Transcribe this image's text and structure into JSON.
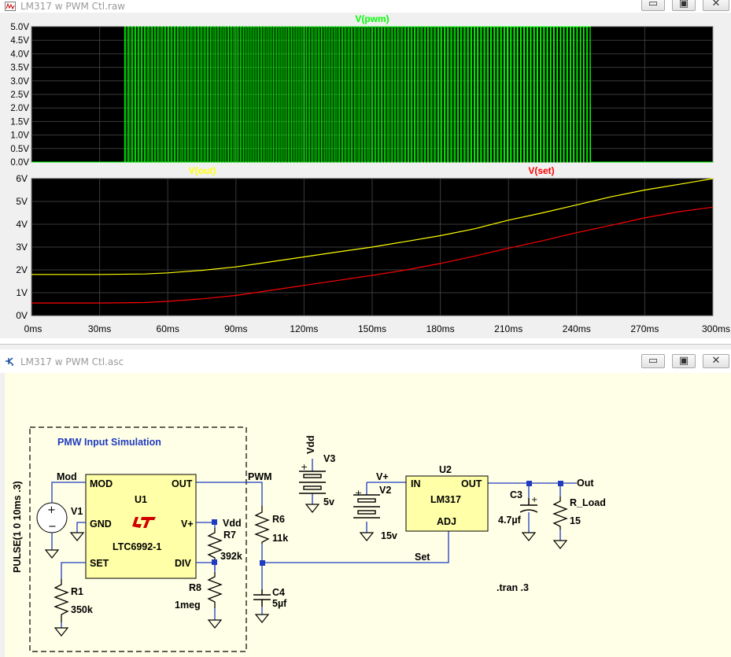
{
  "plot_window": {
    "title": "LM317 w PWM Ctl.raw",
    "controls": {
      "minimize": "▭",
      "restore": "▣",
      "close": "✕"
    }
  },
  "schematic_window": {
    "title": "LM317 w PWM Ctl.asc",
    "controls": {
      "minimize": "▭",
      "restore": "▣",
      "close": "✕"
    }
  },
  "chart_data": [
    {
      "type": "line",
      "title": "",
      "series": [
        {
          "name": "V(pwm)",
          "color": "#00ff00",
          "x_on": [
            41,
            246
          ],
          "low": 0,
          "high": 5
        }
      ],
      "ylim": [
        0,
        5.0
      ],
      "y_ticks": [
        "5.0V",
        "4.5V",
        "4.0V",
        "3.5V",
        "3.0V",
        "2.5V",
        "2.0V",
        "1.5V",
        "1.0V",
        "0.5V",
        "0.0V"
      ],
      "xlim": [
        0,
        300
      ],
      "grid": true,
      "background": "#000000"
    },
    {
      "type": "line",
      "title": "",
      "series": [
        {
          "name": "V(out)",
          "color": "#ffff00",
          "x": [
            0,
            30,
            50,
            60,
            75,
            90,
            105,
            120,
            135,
            150,
            165,
            180,
            195,
            210,
            225,
            240,
            255,
            270,
            285,
            300
          ],
          "y": [
            1.8,
            1.8,
            1.82,
            1.87,
            1.98,
            2.13,
            2.35,
            2.57,
            2.79,
            3.0,
            3.25,
            3.5,
            3.8,
            4.18,
            4.5,
            4.85,
            5.2,
            5.5,
            5.75,
            6.0
          ]
        },
        {
          "name": "V(set)",
          "color": "#ff0000",
          "x": [
            0,
            30,
            50,
            60,
            75,
            90,
            105,
            120,
            135,
            150,
            165,
            180,
            195,
            210,
            225,
            240,
            255,
            270,
            285,
            300
          ],
          "y": [
            0.55,
            0.55,
            0.57,
            0.62,
            0.73,
            0.88,
            1.1,
            1.32,
            1.54,
            1.76,
            2.0,
            2.28,
            2.6,
            2.95,
            3.28,
            3.63,
            3.95,
            4.28,
            4.55,
            4.75
          ]
        }
      ],
      "ylim": [
        0,
        6
      ],
      "y_ticks": [
        "6V",
        "5V",
        "4V",
        "3V",
        "2V",
        "1V",
        "0V"
      ],
      "xlim": [
        0,
        300
      ],
      "x_ticks": [
        "0ms",
        "30ms",
        "60ms",
        "90ms",
        "120ms",
        "150ms",
        "180ms",
        "210ms",
        "240ms",
        "270ms",
        "300ms"
      ],
      "grid": true,
      "background": "#000000"
    }
  ],
  "schematic": {
    "box_title": "PMW Input Simulation",
    "u1": {
      "ref": "U1",
      "part": "LTC6992-1",
      "pins": {
        "mod": "MOD",
        "out": "OUT",
        "gnd": "GND",
        "vplus": "V+",
        "set": "SET",
        "div": "DIV"
      }
    },
    "u2": {
      "ref": "U2",
      "part": "LM317",
      "pins": {
        "in": "IN",
        "out": "OUT",
        "adj": "ADJ"
      }
    },
    "v1": {
      "ref": "V1",
      "value": "PULSE(1 0 10ms .3)"
    },
    "v2": {
      "ref": "V2",
      "value": "15v"
    },
    "v3": {
      "ref": "V3",
      "value": "5v"
    },
    "r1": {
      "ref": "R1",
      "value": "350k"
    },
    "r6": {
      "ref": "R6",
      "value": "11k"
    },
    "r7": {
      "ref": "R7",
      "value": "392k"
    },
    "r8": {
      "ref": "R8",
      "value": "1meg"
    },
    "r_load": {
      "ref": "R_Load",
      "value": "15"
    },
    "c3": {
      "ref": "C3",
      "value": "4.7µf"
    },
    "c4": {
      "ref": "C4",
      "value": "5µf"
    },
    "nets": {
      "mod": "Mod",
      "pwm": "PWM",
      "vdd_u1": "Vdd",
      "vdd_v3": "Vdd",
      "vplus": "V+",
      "set": "Set",
      "out": "Out"
    },
    "directive": ".tran .3"
  }
}
